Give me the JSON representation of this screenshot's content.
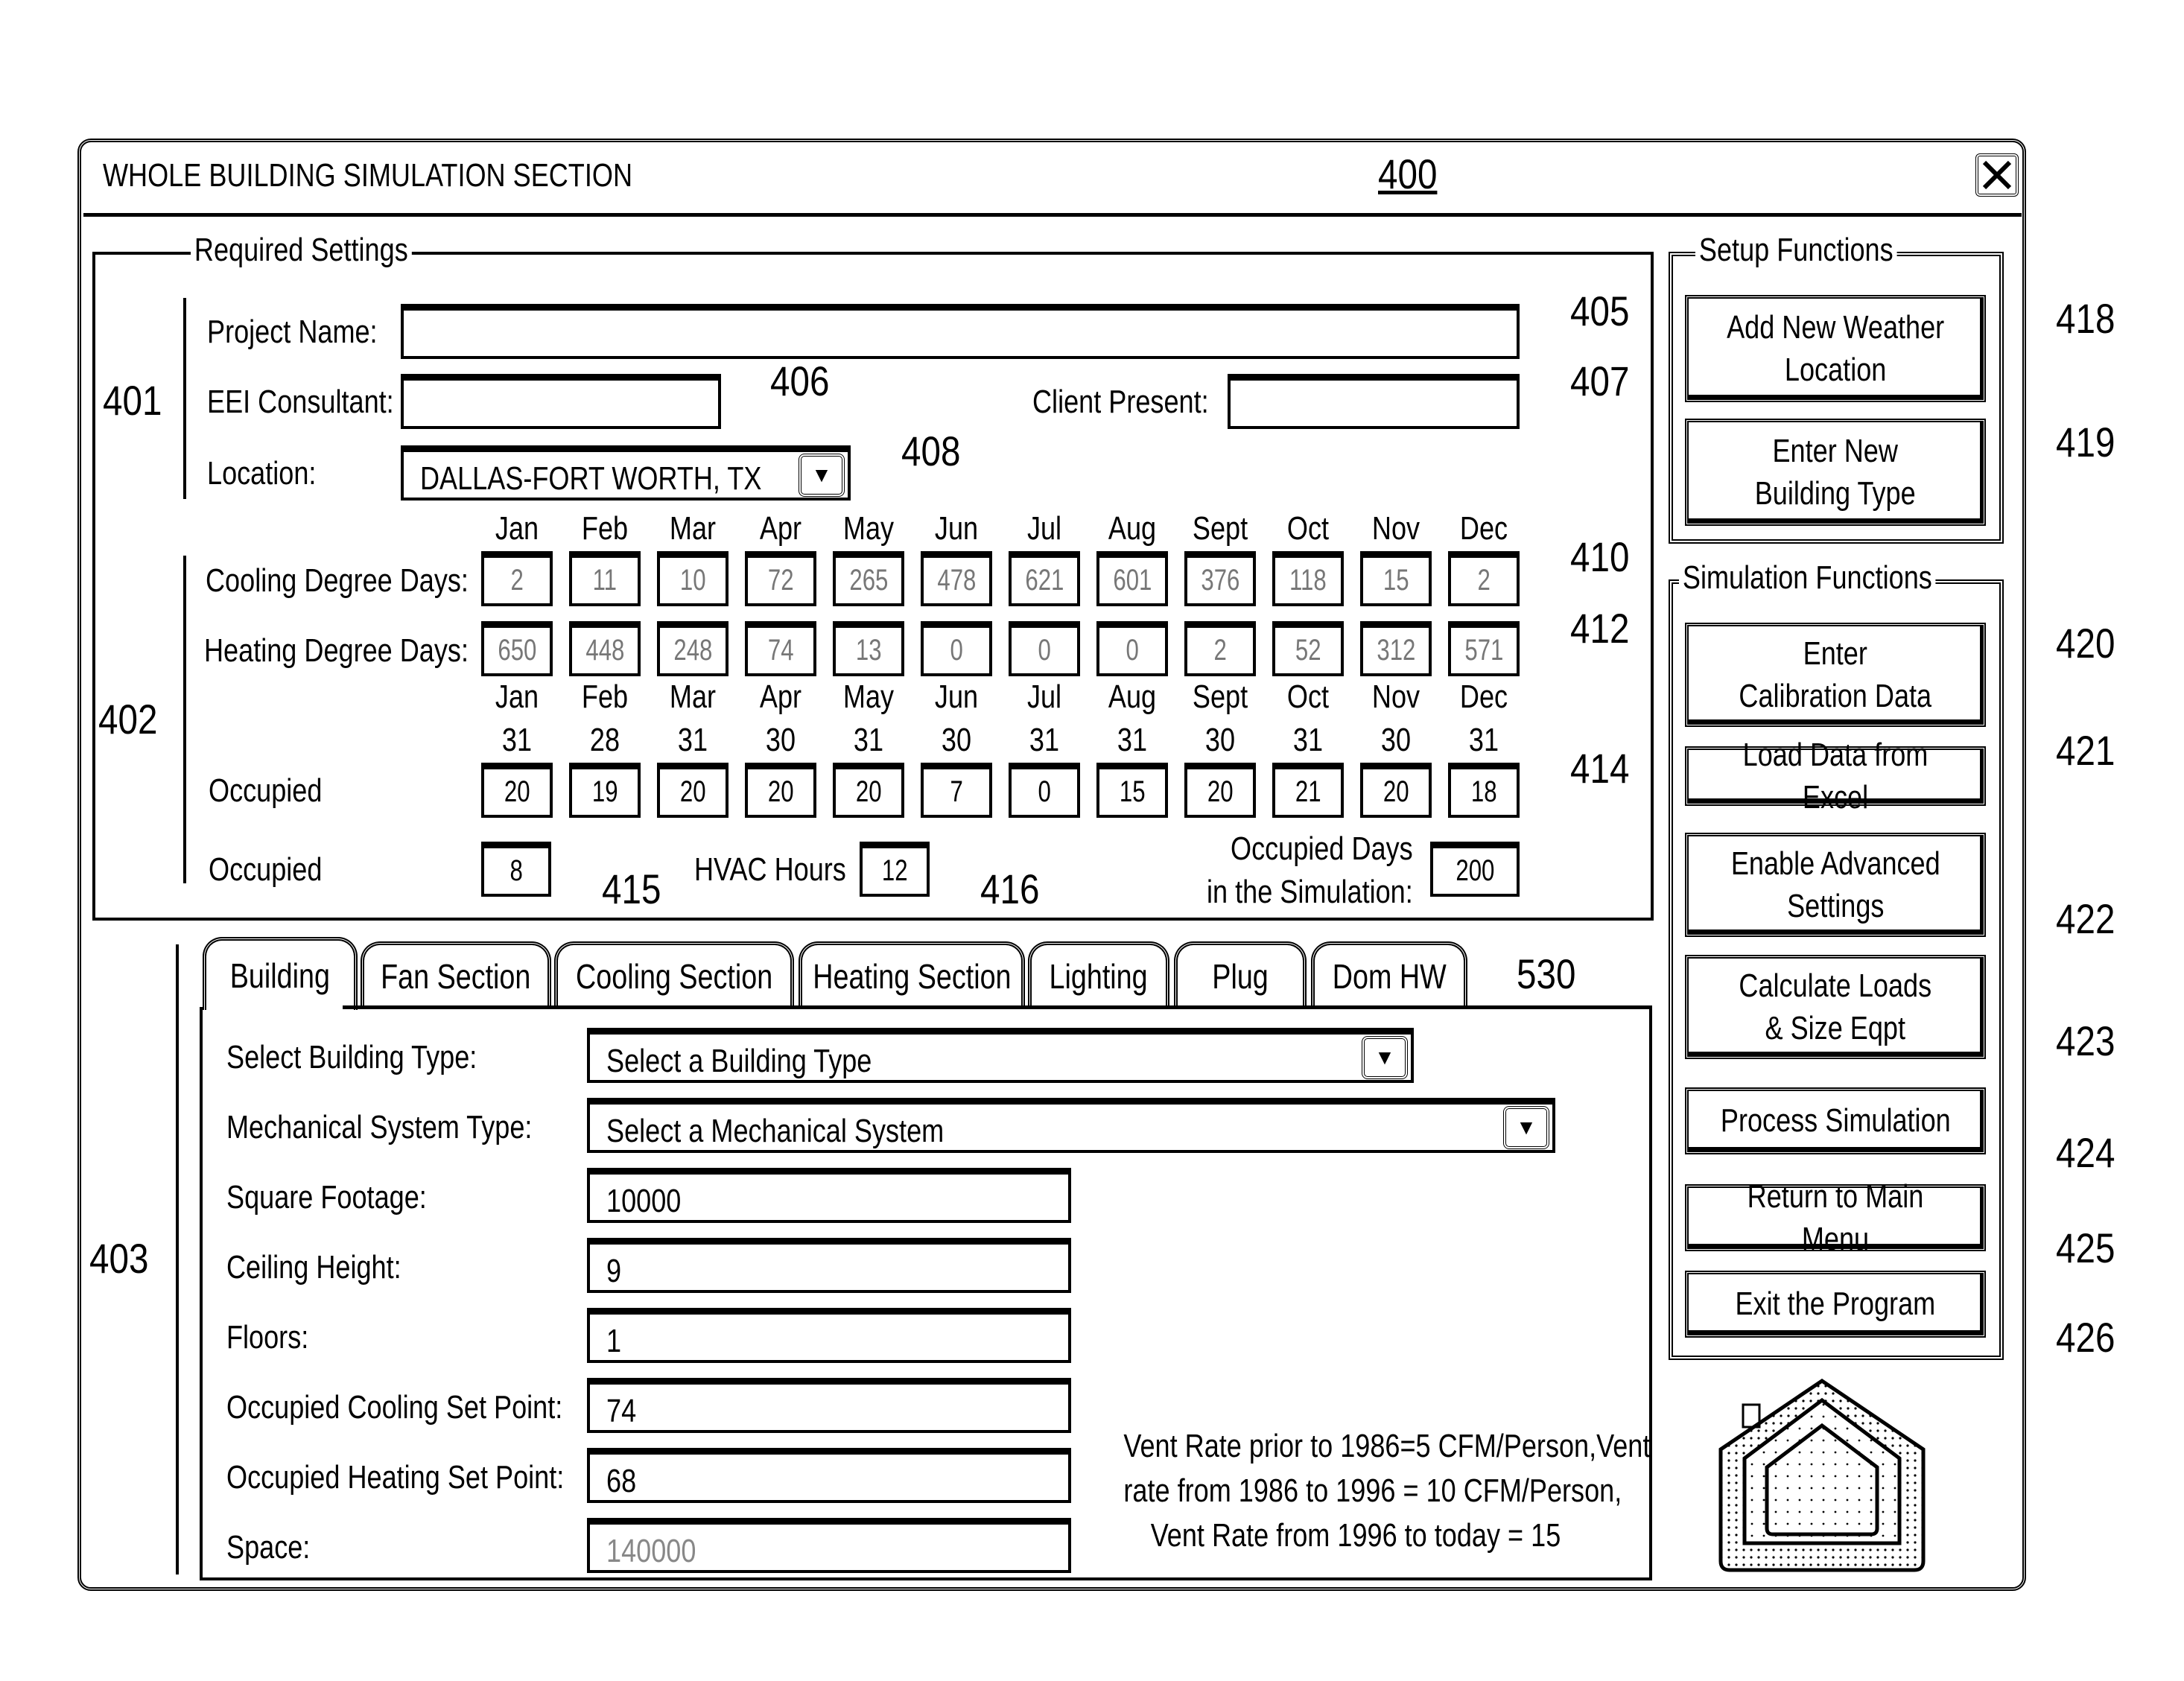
{
  "window": {
    "title": "WHOLE BUILDING SIMULATION SECTION",
    "figure_ref": "400",
    "close_icon": "close-x-icon"
  },
  "required_settings": {
    "legend": "Required Settings",
    "ref_401": "401",
    "project_name": {
      "label": "Project Name:",
      "value": "",
      "ref": "405"
    },
    "eei_consultant": {
      "label": "EEI Consultant:",
      "value": "",
      "ref": "406"
    },
    "client_present": {
      "label": "Client Present:",
      "value": "",
      "ref": "407"
    },
    "location": {
      "label": "Location:",
      "value": "DALLAS-FORT WORTH, TX",
      "ref": "408",
      "dropdown_icon": "triangle-down-icon"
    },
    "ref_402": "402",
    "months": [
      "Jan",
      "Feb",
      "Mar",
      "Apr",
      "May",
      "Jun",
      "Jul",
      "Aug",
      "Sept",
      "Oct",
      "Nov",
      "Dec"
    ],
    "days_in_month": [
      "31",
      "28",
      "31",
      "30",
      "31",
      "30",
      "31",
      "31",
      "30",
      "31",
      "30",
      "31"
    ],
    "cooling_degree_days": {
      "label": "Cooling Degree Days:",
      "ref": "410",
      "values": [
        "2",
        "11",
        "10",
        "72",
        "265",
        "478",
        "621",
        "601",
        "376",
        "118",
        "15",
        "2"
      ]
    },
    "heating_degree_days": {
      "label": "Heating Degree Days:",
      "ref": "412",
      "values": [
        "650",
        "448",
        "248",
        "74",
        "13",
        "0",
        "0",
        "0",
        "2",
        "52",
        "312",
        "571"
      ]
    },
    "occupied_days": {
      "label": "Occupied",
      "ref": "414",
      "values": [
        "20",
        "19",
        "20",
        "20",
        "20",
        "7",
        "0",
        "15",
        "20",
        "21",
        "20",
        "18"
      ]
    },
    "occupied_hours": {
      "label": "Occupied",
      "value": "8",
      "ref": "415"
    },
    "hvac_hours": {
      "label": "HVAC Hours",
      "value": "12",
      "ref": "416"
    },
    "occupied_days_sim": {
      "label_line1": "Occupied Days",
      "label_line2": "in the Simulation:",
      "value": "200"
    }
  },
  "tabs_section": {
    "ref_403": "403",
    "ref_530": "530",
    "tabs": [
      {
        "label": "Building",
        "active": true
      },
      {
        "label": "Fan Section"
      },
      {
        "label": "Cooling Section"
      },
      {
        "label": "Heating Section"
      },
      {
        "label": "Lighting"
      },
      {
        "label": "Plug"
      },
      {
        "label": "Dom HW"
      }
    ],
    "building": {
      "building_type": {
        "label": "Select Building Type:",
        "value": "Select a Building Type"
      },
      "mechanical_system": {
        "label": "Mechanical System Type:",
        "value": "Select a Mechanical System"
      },
      "square_footage": {
        "label": "Square Footage:",
        "value": "10000"
      },
      "ceiling_height": {
        "label": "Ceiling Height:",
        "value": "9"
      },
      "floors": {
        "label": "Floors:",
        "value": "1"
      },
      "cooling_set_point": {
        "label": "Occupied Cooling Set Point:",
        "value": "74"
      },
      "heating_set_point": {
        "label": "Occupied Heating Set Point:",
        "value": "68"
      },
      "space": {
        "label": "Space:",
        "value": "140000"
      },
      "vent_note": [
        "Vent Rate prior to 1986=5 CFM/Person,Vent",
        "rate from 1986 to 1996 = 10 CFM/Person,",
        "Vent Rate from 1996 to today = 15"
      ]
    }
  },
  "setup_functions": {
    "legend": "Setup Functions",
    "buttons": [
      {
        "label": "Add New Weather\nLocation",
        "ref": "418"
      },
      {
        "label": "Enter New\nBuilding Type",
        "ref": "419"
      }
    ]
  },
  "simulation_functions": {
    "legend": "Simulation Functions",
    "buttons": [
      {
        "label": "Enter\nCalibration Data",
        "ref": "420"
      },
      {
        "label": "Load Data from Excel",
        "ref": "421"
      },
      {
        "label": "Enable Advanced\nSettings",
        "ref": "422"
      },
      {
        "label": "Calculate Loads\n& Size Eqpt",
        "ref": "423"
      },
      {
        "label": "Process Simulation",
        "ref": "424"
      },
      {
        "label": "Return to Main Menu",
        "ref": "425"
      },
      {
        "label": "Exit the Program",
        "ref": "426"
      }
    ]
  },
  "logo": {
    "icon": "house-logo-icon"
  }
}
